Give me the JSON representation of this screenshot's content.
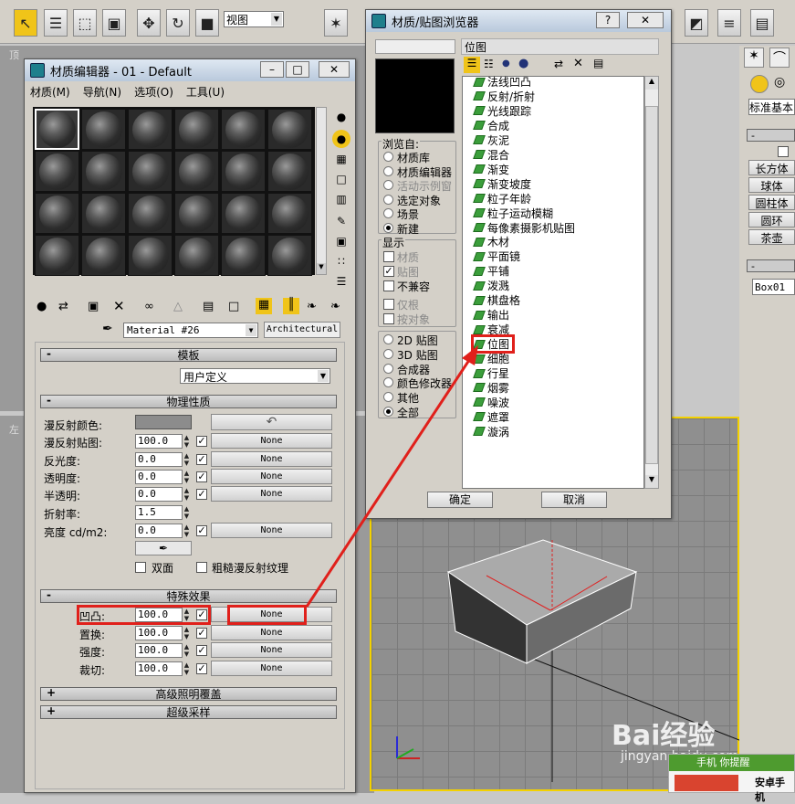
{
  "toolbar": {
    "view_select": "视图"
  },
  "viewport_labels": {
    "top": "顶",
    "left": "左"
  },
  "mat_editor": {
    "title": "材质编辑器 - 01 - Default",
    "menu": [
      "材质(M)",
      "导航(N)",
      "选项(O)",
      "工具(U)"
    ],
    "material_name": "Material #26",
    "material_type": "Architectural",
    "rollout_template": "模板",
    "template_value": "用户定义",
    "rollout_physical": "物理性质",
    "props": [
      {
        "label": "漫反射颜色:"
      },
      {
        "label": "漫反射贴图:",
        "value": "100.0",
        "map": "None"
      },
      {
        "label": "反光度:",
        "value": "0.0",
        "map": "None"
      },
      {
        "label": "透明度:",
        "value": "0.0",
        "map": "None"
      },
      {
        "label": "半透明:",
        "value": "0.0",
        "map": "None"
      },
      {
        "label": "折射率:",
        "value": "1.5"
      },
      {
        "label": "亮度 cd/m2:",
        "value": "0.0",
        "map": "None"
      }
    ],
    "two_sided": "双面",
    "rough_diffuse": "粗糙漫反射纹理",
    "rollout_special": "特殊效果",
    "special": [
      {
        "label": "凹凸:",
        "value": "100.0",
        "map": "None"
      },
      {
        "label": "置换:",
        "value": "100.0",
        "map": "None"
      },
      {
        "label": "强度:",
        "value": "100.0",
        "map": "None"
      },
      {
        "label": "裁切:",
        "value": "100.0",
        "map": "None"
      }
    ],
    "rollout_advanced": "高级照明覆盖",
    "rollout_super": "超级采样",
    "rollout_sign_minus": "-",
    "rollout_sign_plus": "+"
  },
  "browser": {
    "title": "材质/贴图浏览器",
    "help": "?",
    "selected_name": "位图",
    "browse_from_title": "浏览自:",
    "browse_from": [
      "材质库",
      "材质编辑器",
      "活动示例窗",
      "选定对象",
      "场景",
      "新建"
    ],
    "show_title": "显示",
    "show": [
      "材质",
      "贴图",
      "不兼容"
    ],
    "only": [
      "仅根",
      "按对象"
    ],
    "filters": [
      "2D 贴图",
      "3D 贴图",
      "合成器",
      "颜色修改器",
      "其他",
      "全部"
    ],
    "maps": [
      "法线凹凸",
      "反射/折射",
      "光线跟踪",
      "合成",
      "灰泥",
      "混合",
      "渐变",
      "渐变坡度",
      "粒子年龄",
      "粒子运动模糊",
      "每像素摄影机贴图",
      "木材",
      "平面镜",
      "平铺",
      "泼溅",
      "棋盘格",
      "输出",
      "衰减",
      "位图",
      "细胞",
      "行星",
      "烟雾",
      "噪波",
      "遮罩",
      "漩涡"
    ],
    "ok": "确定",
    "cancel": "取消"
  },
  "right_panel": {
    "standard": "标准基本",
    "buttons": [
      "长方体",
      "球体",
      "圆柱体",
      "圆环",
      "茶壶"
    ],
    "object_name": "Box01"
  },
  "watermark": {
    "brand": "Bai经验",
    "url": "jingyan.baidu.com",
    "notice": "手机 你提醒",
    "notice2": "安卓手机"
  }
}
